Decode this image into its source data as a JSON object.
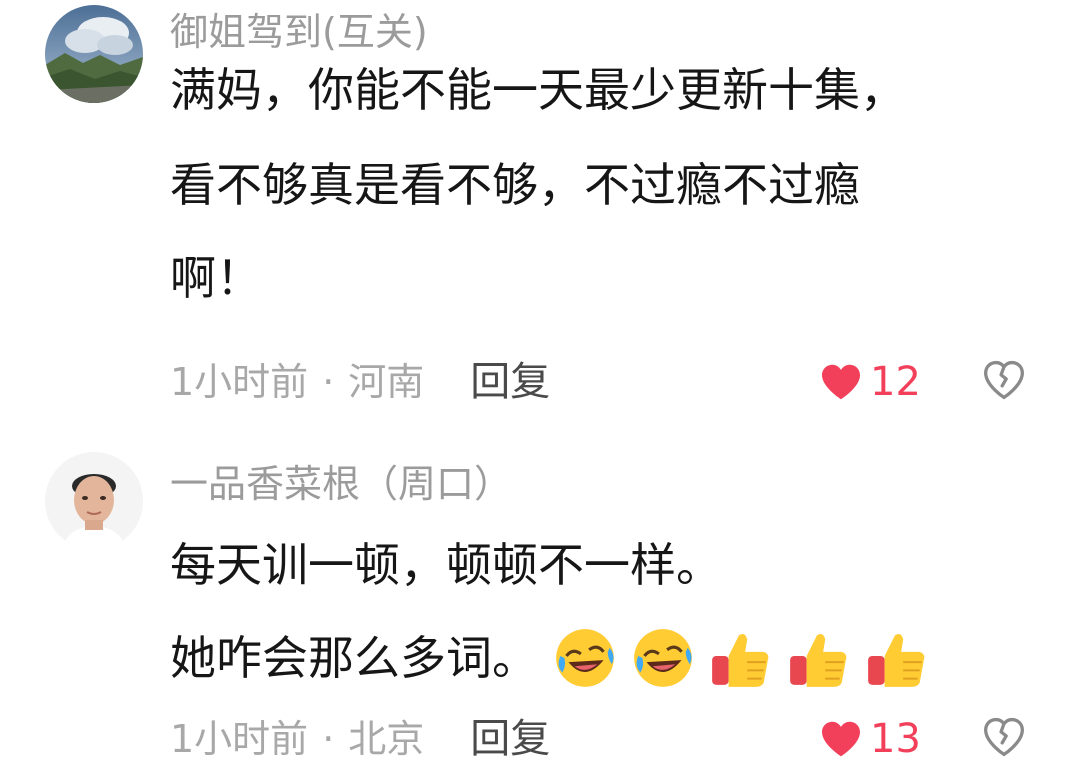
{
  "comments": [
    {
      "username": "御姐驾到(互关)",
      "lines": [
        "满妈，你能不能一天最少更新十集，",
        "看不够真是看不够，不过瘾不过瘾",
        "啊！"
      ],
      "time": "1小时前",
      "location": "河南",
      "reply_label": "回复",
      "likes": "12"
    },
    {
      "username": "一品香菜根（周口）",
      "lines": [
        "每天训一顿，顿顿不一样。",
        "她咋会那么多词。"
      ],
      "emojis": [
        "rolling-laughing-emoji",
        "rolling-laughing-emoji",
        "thumbs-up-emoji",
        "thumbs-up-emoji",
        "thumbs-up-emoji"
      ],
      "time": "1小时前",
      "location": "北京",
      "reply_label": "回复",
      "likes": "13"
    }
  ],
  "colors": {
    "like": "#f2405b",
    "meta": "#a8a8a8",
    "username": "#9b9b9b",
    "text": "#161616"
  },
  "icons": {
    "like": "heart-icon",
    "dislike": "broken-heart-icon"
  }
}
